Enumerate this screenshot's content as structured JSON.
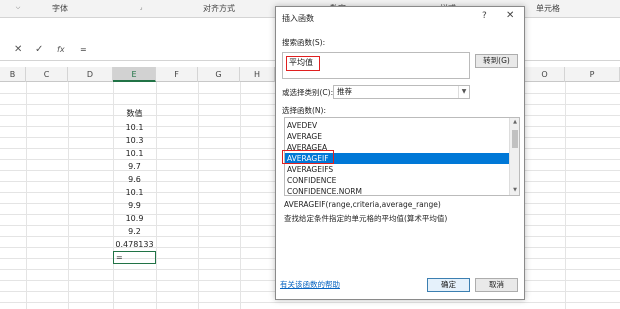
{
  "ribbon": {
    "groups": [
      "字体",
      "对齐方式",
      "数字",
      "样式",
      "单元格"
    ],
    "launcher_icon": "dialog-launcher-icon"
  },
  "formula_bar": {
    "cancel_icon": "✕",
    "enter_icon": "✓",
    "fx_label": "fx",
    "equals": "="
  },
  "columns": [
    "B",
    "C",
    "D",
    "E",
    "F",
    "G",
    "H",
    "O",
    "P"
  ],
  "active_column": "E",
  "cells": {
    "header": "数值",
    "values": [
      "10.1",
      "10.3",
      "10.1",
      "9.7",
      "9.6",
      "10.1",
      "9.9",
      "10.9",
      "9.2",
      "0.478133"
    ],
    "active_cell_value": "="
  },
  "dialog": {
    "title": "插入函数",
    "help": "?",
    "close": "✕",
    "search_label": "搜索函数(S):",
    "search_value": "平均值",
    "go_button": "转到(G)",
    "category_label": "或选择类别(C):",
    "category_value": "推荐",
    "select_label": "选择函数(N):",
    "functions": [
      "AVEDEV",
      "AVERAGE",
      "AVERAGEA",
      "AVERAGEIF",
      "AVERAGEIFS",
      "CONFIDENCE",
      "CONFIDENCE.NORM"
    ],
    "selected_function": "AVERAGEIF",
    "syntax": "AVERAGEIF(range,criteria,average_range)",
    "description": "查找给定条件指定的单元格的平均值(算术平均值)",
    "help_link": "有关该函数的帮助",
    "ok_button": "确定",
    "cancel_button": "取消"
  },
  "colors": {
    "excel_green": "#217346",
    "selection_blue": "#0078d7",
    "highlight_red": "#e02020",
    "link_blue": "#0563c1"
  }
}
